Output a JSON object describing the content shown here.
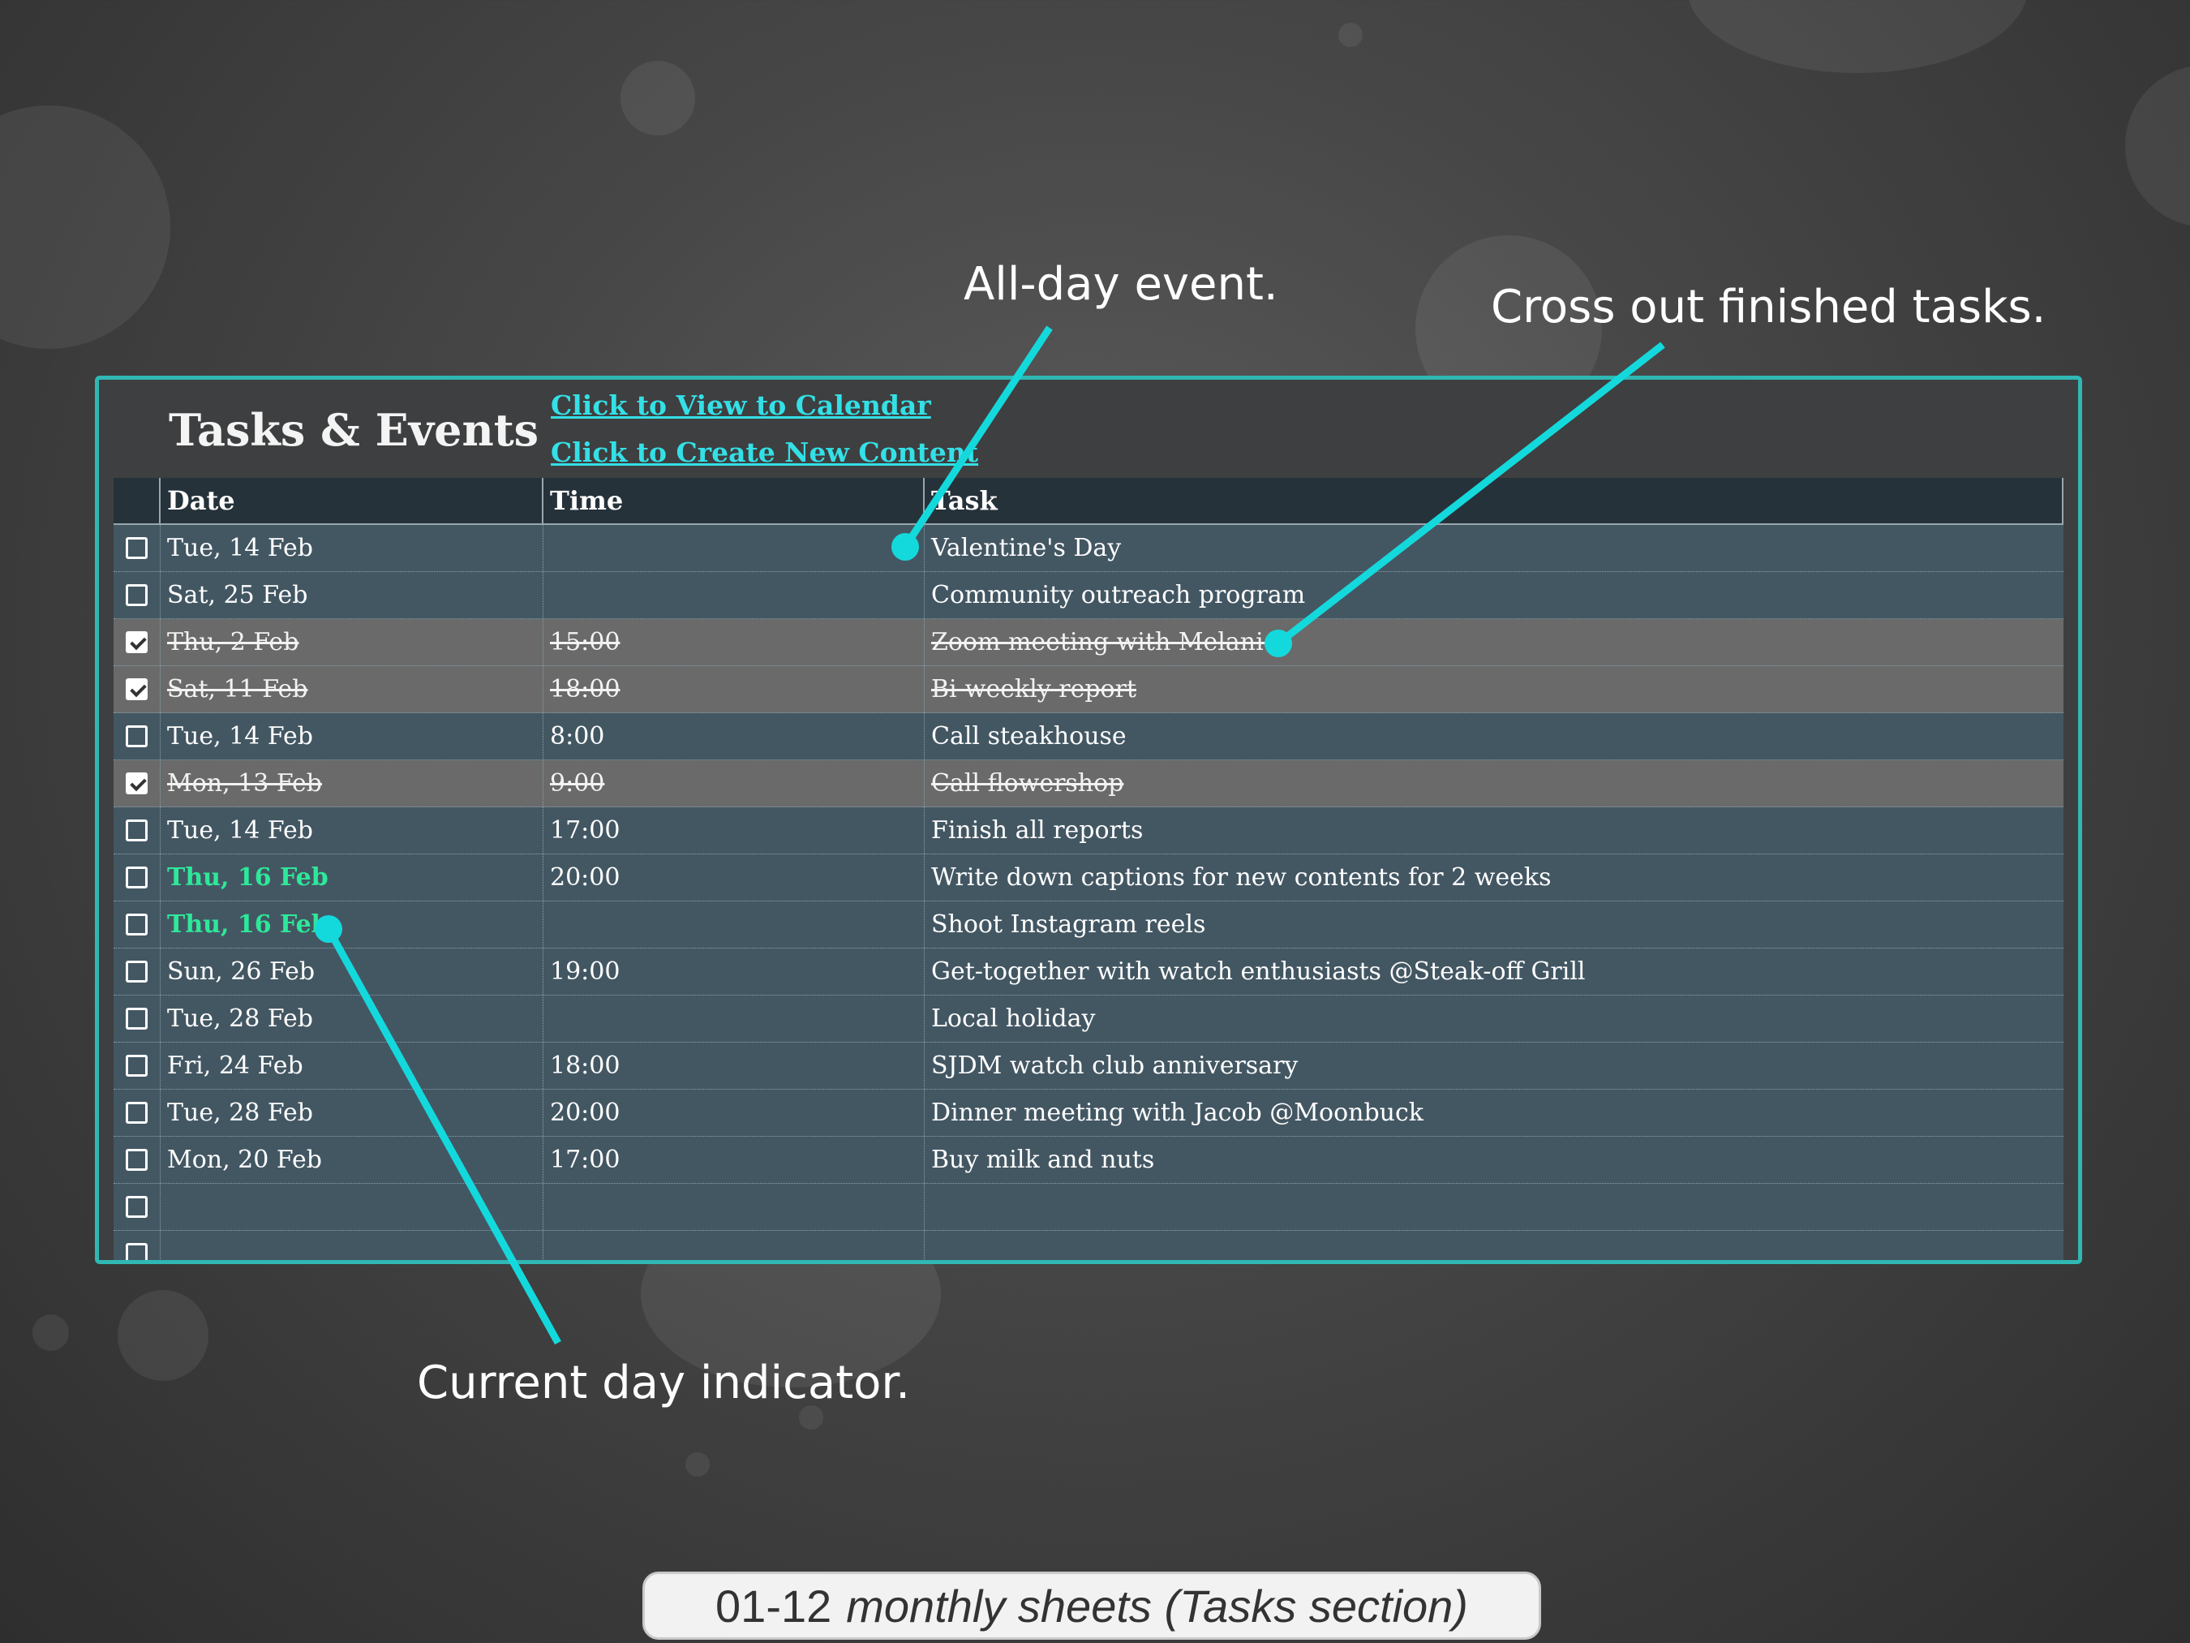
{
  "panel": {
    "title": "Tasks & Events",
    "link_calendar": "Click to View to Calendar",
    "link_create": "Click to Create New Content"
  },
  "table": {
    "headers": {
      "date": "Date",
      "time": "Time",
      "task": "Task"
    },
    "rows": [
      {
        "checked": false,
        "date": "Tue, 14 Feb",
        "time": "",
        "task": "Valentine's Day",
        "done": false,
        "today": false
      },
      {
        "checked": false,
        "date": "Sat, 25 Feb",
        "time": "",
        "task": "Community outreach program",
        "done": false,
        "today": false
      },
      {
        "checked": true,
        "date": "Thu, 2 Feb",
        "time": "15:00",
        "task": "Zoom meeting with Melanie",
        "done": true,
        "today": false
      },
      {
        "checked": true,
        "date": "Sat, 11 Feb",
        "time": "18:00",
        "task": "Bi-weekly report",
        "done": true,
        "today": false
      },
      {
        "checked": false,
        "date": "Tue, 14 Feb",
        "time": "8:00",
        "task": "Call steakhouse",
        "done": false,
        "today": false
      },
      {
        "checked": true,
        "date": "Mon, 13 Feb",
        "time": "9:00",
        "task": "Call flowershop",
        "done": true,
        "today": false
      },
      {
        "checked": false,
        "date": "Tue, 14 Feb",
        "time": "17:00",
        "task": "Finish all reports",
        "done": false,
        "today": false
      },
      {
        "checked": false,
        "date": "Thu, 16 Feb",
        "time": "20:00",
        "task": "Write down captions for new contents for 2 weeks",
        "done": false,
        "today": true
      },
      {
        "checked": false,
        "date": "Thu, 16 Feb",
        "time": "",
        "task": "Shoot Instagram reels",
        "done": false,
        "today": true
      },
      {
        "checked": false,
        "date": "Sun, 26 Feb",
        "time": "19:00",
        "task": "Get-together with watch enthusiasts @Steak-off Grill",
        "done": false,
        "today": false
      },
      {
        "checked": false,
        "date": "Tue, 28 Feb",
        "time": "",
        "task": "Local holiday",
        "done": false,
        "today": false
      },
      {
        "checked": false,
        "date": "Fri, 24 Feb",
        "time": "18:00",
        "task": "SJDM watch club anniversary",
        "done": false,
        "today": false
      },
      {
        "checked": false,
        "date": "Tue, 28 Feb",
        "time": "20:00",
        "task": "Dinner meeting with Jacob @Moonbuck",
        "done": false,
        "today": false
      },
      {
        "checked": false,
        "date": "Mon, 20 Feb",
        "time": "17:00",
        "task": "Buy milk and nuts",
        "done": false,
        "today": false
      },
      {
        "checked": false,
        "date": "",
        "time": "",
        "task": "",
        "done": false,
        "today": false
      },
      {
        "checked": false,
        "date": "",
        "time": "",
        "task": "",
        "done": false,
        "today": false
      }
    ]
  },
  "callouts": {
    "all_day": "All-day event.",
    "cross_out": "Cross out finished tasks.",
    "current_day": "Current day indicator."
  },
  "caption": {
    "prefix": "01-12",
    "italic": "monthly sheets (Tasks section)"
  },
  "colors": {
    "accent": "#2fb8b4",
    "callout": "#14d9dc",
    "link": "#33e0e6",
    "today": "#2ee89a",
    "row": "#435763",
    "row_done": "#6a6a6a",
    "header": "#26323a"
  }
}
